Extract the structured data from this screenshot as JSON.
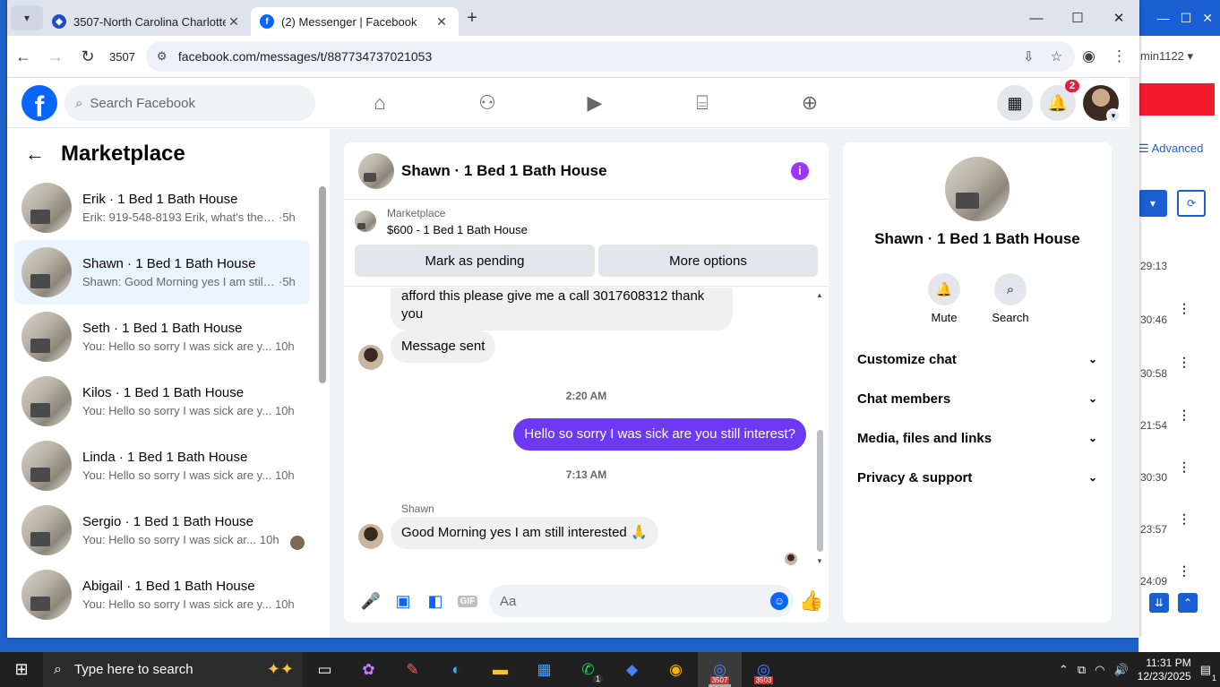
{
  "browser": {
    "tabs": [
      {
        "title": "3507-North Carolina Charlotte-",
        "close": "✕"
      },
      {
        "title": "(2) Messenger | Facebook",
        "close": "✕"
      }
    ],
    "new_tab": "+",
    "profile_label": "3507",
    "url": "facebook.com/messages/t/887734737021053",
    "window_controls": {
      "minimize": "—",
      "maximize": "☐",
      "close": "✕"
    }
  },
  "background_app": {
    "user": "min1122 ▾",
    "advanced": "Advanced",
    "rows": [
      {
        "time": "29:13"
      },
      {
        "time": "30:46"
      },
      {
        "time": "30:58"
      },
      {
        "time": "21:54"
      },
      {
        "time": "30:30"
      },
      {
        "time": "23:57"
      },
      {
        "time": "24:09"
      }
    ]
  },
  "facebook": {
    "search_placeholder": "Search Facebook",
    "notification_count": "2"
  },
  "sidebar": {
    "title": "Marketplace",
    "conversations": [
      {
        "name": "Erik · 1 Bed 1 Bath House",
        "preview": "Erik: 919-548-8193 Erik, what's the ...",
        "time": "·5h",
        "selected": false
      },
      {
        "name": "Shawn · 1 Bed 1 Bath House",
        "preview": "Shawn: Good Morning yes I am still...",
        "time": "·5h",
        "selected": true
      },
      {
        "name": "Seth · 1 Bed 1 Bath House",
        "preview": "You: Hello so sorry I was sick are y...",
        "time": "10h",
        "selected": false
      },
      {
        "name": "Kilos · 1 Bed 1 Bath House",
        "preview": "You: Hello so sorry I was sick are y...",
        "time": "10h",
        "selected": false
      },
      {
        "name": "Linda · 1 Bed 1 Bath House",
        "preview": "You: Hello so sorry I was sick are y...",
        "time": "10h",
        "selected": false
      },
      {
        "name": "Sergio · 1 Bed 1 Bath House",
        "preview": "You: Hello so sorry I was sick ar...",
        "time": "10h",
        "selected": false
      },
      {
        "name": "Abigail · 1 Bed 1 Bath House",
        "preview": "You: Hello so sorry I was sick are y...",
        "time": "10h",
        "selected": false
      }
    ]
  },
  "chat": {
    "title": "Shawn · 1 Bed 1 Bath House",
    "marketplace_label": "Marketplace",
    "listing": "$600 - 1 Bed 1 Bath House",
    "mark_pending": "Mark as pending",
    "more_options": "More options",
    "messages": {
      "partial": "afford this please give me a call 3017608312 thank you",
      "sent_notice": "Message sent",
      "time1": "2:20 AM",
      "outgoing": "Hello so sorry I was sick are you still interest?",
      "time2": "7:13 AM",
      "sender": "Shawn",
      "incoming": "Good Morning yes I am still interested 🙏"
    },
    "composer_placeholder": "Aa"
  },
  "info_panel": {
    "name": "Shawn · 1 Bed 1 Bath House",
    "mute": "Mute",
    "search": "Search",
    "sections": [
      "Customize chat",
      "Chat members",
      "Media, files and links",
      "Privacy & support"
    ]
  },
  "taskbar": {
    "search_placeholder": "Type here to search",
    "time": "11:31 PM",
    "date": "12/23/2025",
    "notifications": "1",
    "whatsapp_badge": "1",
    "app_label_1": "3507",
    "app_label_2": "3503"
  }
}
